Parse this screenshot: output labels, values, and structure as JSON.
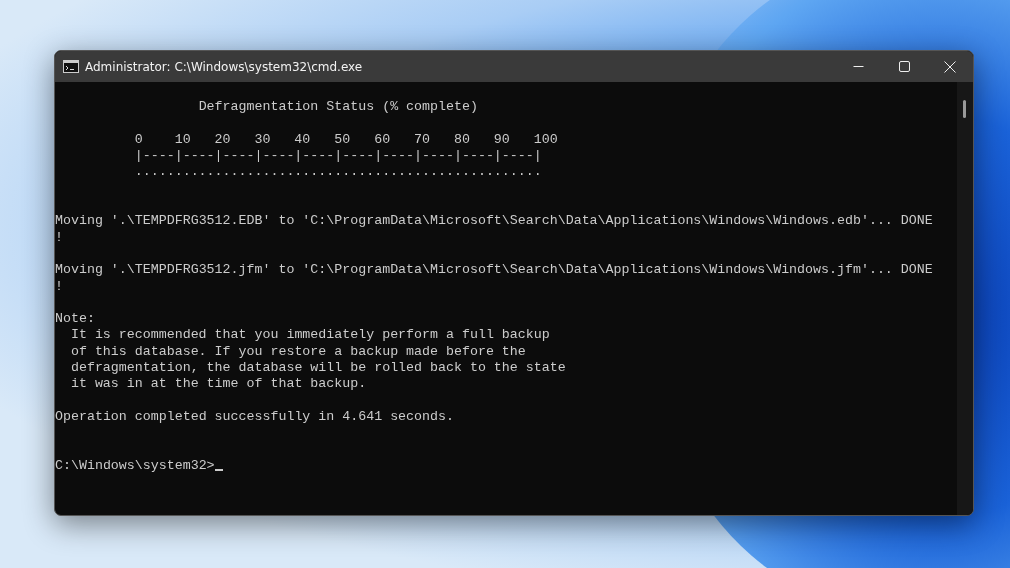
{
  "window": {
    "title": "Administrator: C:\\Windows\\system32\\cmd.exe"
  },
  "console": {
    "lines": [
      {
        "kind": "blank"
      },
      {
        "kind": "heading",
        "text": "Defragmentation Status (% complete)"
      },
      {
        "kind": "blank"
      },
      {
        "kind": "scale",
        "text": "0    10   20   30   40   50   60   70   80   90   100"
      },
      {
        "kind": "scale",
        "text": "|----|----|----|----|----|----|----|----|----|----|"
      },
      {
        "kind": "scale",
        "text": "..................................................."
      },
      {
        "kind": "blank"
      },
      {
        "kind": "blank"
      },
      {
        "kind": "text",
        "text": "Moving '.\\TEMPDFRG3512.EDB' to 'C:\\ProgramData\\Microsoft\\Search\\Data\\Applications\\Windows\\Windows.edb'... DONE"
      },
      {
        "kind": "text",
        "text": "!"
      },
      {
        "kind": "blank"
      },
      {
        "kind": "text",
        "text": "Moving '.\\TEMPDFRG3512.jfm' to 'C:\\ProgramData\\Microsoft\\Search\\Data\\Applications\\Windows\\Windows.jfm'... DONE"
      },
      {
        "kind": "text",
        "text": "!"
      },
      {
        "kind": "blank"
      },
      {
        "kind": "text",
        "text": "Note:"
      },
      {
        "kind": "note",
        "text": "It is recommended that you immediately perform a full backup"
      },
      {
        "kind": "note",
        "text": "of this database. If you restore a backup made before the"
      },
      {
        "kind": "note",
        "text": "defragmentation, the database will be rolled back to the state"
      },
      {
        "kind": "note",
        "text": "it was in at the time of that backup."
      },
      {
        "kind": "blank"
      },
      {
        "kind": "text",
        "text": "Operation completed successfully in 4.641 seconds."
      },
      {
        "kind": "blank"
      },
      {
        "kind": "blank"
      },
      {
        "kind": "prompt",
        "text": "C:\\Windows\\system32>"
      }
    ]
  }
}
